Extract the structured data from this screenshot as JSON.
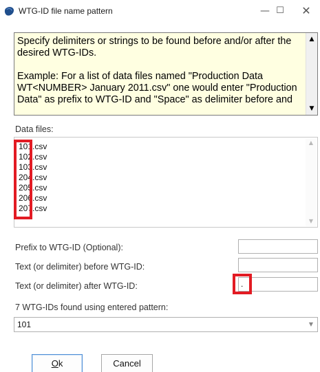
{
  "window": {
    "title": "WTG-ID file name pattern",
    "icon": "app-icon",
    "controls": {
      "minimize": "—",
      "maximize": "☐",
      "close": "✕"
    }
  },
  "help": {
    "paragraph1": "Specify delimiters or strings to be found before and/or after the desired WTG-IDs.",
    "paragraph2": "Example: For a list of data files named \"Production Data WT<NUMBER> January 2011.csv\" one would enter \"Production Data\" as prefix to WTG-ID and \"Space\" as delimiter before and"
  },
  "data_files": {
    "label": "Data files:",
    "items": [
      "101.csv",
      "102.csv",
      "103.csv",
      "204.csv",
      "205.csv",
      "206.csv",
      "207.csv"
    ]
  },
  "fields": {
    "prefix_label": "Prefix to WTG-ID (Optional):",
    "prefix_value": "",
    "before_label": "Text (or delimiter) before WTG-ID:",
    "before_value": "",
    "after_label": "Text (or delimiter) after WTG-ID:",
    "after_value": "."
  },
  "result": {
    "label": "7 WTG-IDs found using entered pattern:",
    "selected": "101"
  },
  "buttons": {
    "ok_mnemonic": "O",
    "ok_rest": "k",
    "cancel": "Cancel"
  },
  "colors": {
    "help_background": "#ffffe1",
    "highlight": "#e21b23",
    "ok_border": "#4f8fd6"
  }
}
